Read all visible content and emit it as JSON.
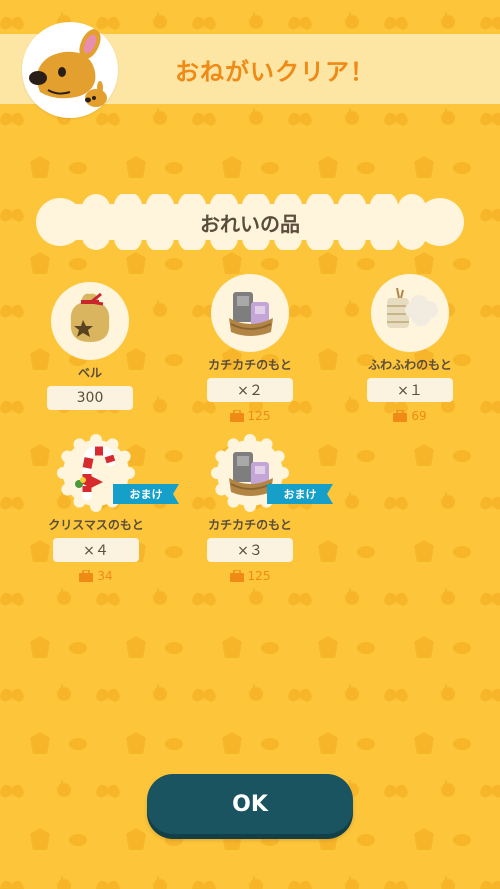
{
  "header": {
    "title": "おねがいクリア！"
  },
  "reward": {
    "title": "おれいの品"
  },
  "items": [
    {
      "name": "ベル",
      "count": "300",
      "cost": "",
      "bonus": ""
    },
    {
      "name": "カチカチのもと",
      "count": "×２",
      "cost": "125",
      "bonus": ""
    },
    {
      "name": "ふわふわのもと",
      "count": "×１",
      "cost": "69",
      "bonus": ""
    },
    {
      "name": "クリスマスのもと",
      "count": "×４",
      "cost": "34",
      "bonus": "おまけ"
    },
    {
      "name": "カチカチのもと",
      "count": "×３",
      "cost": "125",
      "bonus": "おまけ"
    }
  ],
  "ok_button": {
    "label": "OK"
  },
  "colors": {
    "background": "#fdc53a",
    "accent_orange": "#ef8a17",
    "button_teal": "#1b5461",
    "ribbon_blue": "#159fc9"
  },
  "icons": [
    "deer-avatar-icon",
    "bell-bag-icon",
    "stone-material-icon",
    "wool-material-icon",
    "candy-cane-icon",
    "toolbox-icon"
  ]
}
